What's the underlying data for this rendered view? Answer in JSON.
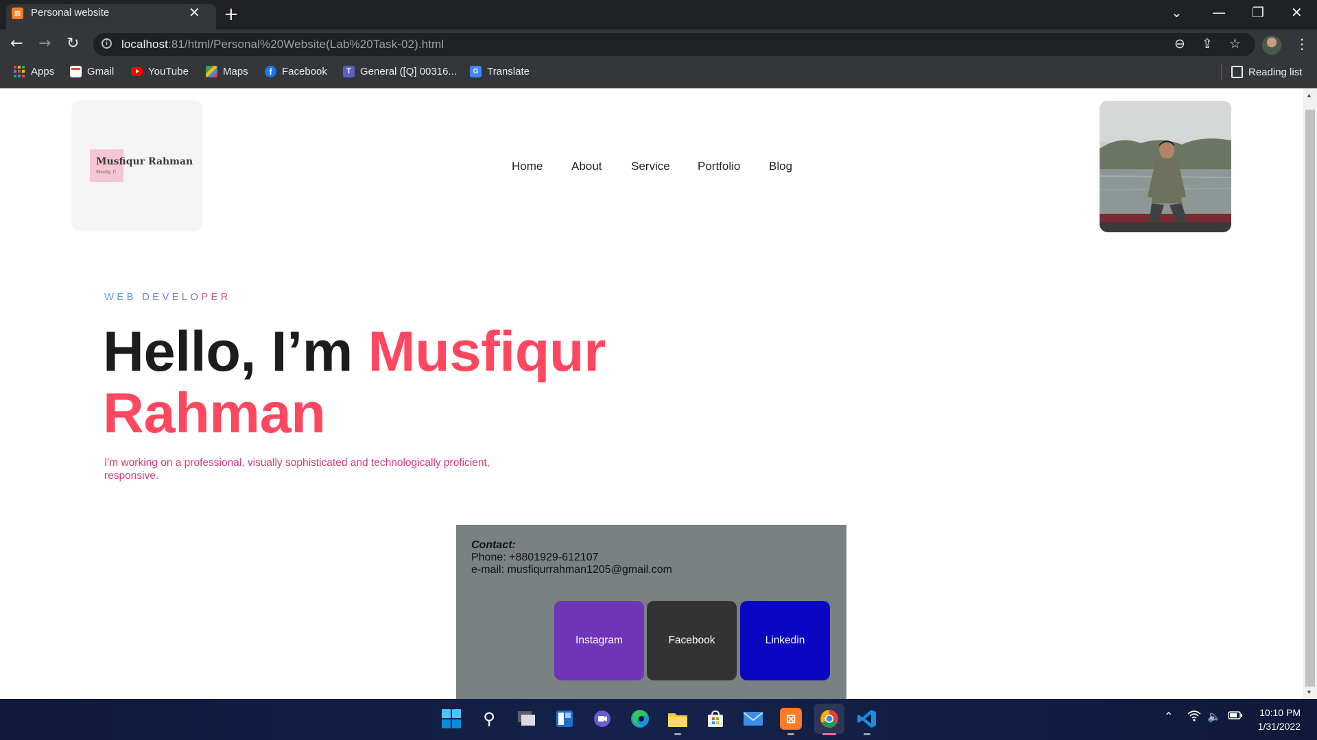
{
  "browser": {
    "tab_title": "Personal website",
    "new_tab": "+",
    "url_host": "localhost",
    "url_path": ":81/html/Personal%20Website(Lab%20Task-02).html",
    "bookmarks": [
      {
        "label": "Apps",
        "icon": "apps-grid-icon"
      },
      {
        "label": "Gmail",
        "icon": "gmail-icon"
      },
      {
        "label": "YouTube",
        "icon": "youtube-icon"
      },
      {
        "label": "Maps",
        "icon": "maps-icon"
      },
      {
        "label": "Facebook",
        "icon": "facebook-icon"
      },
      {
        "label": "General ([Q] 00316...",
        "icon": "teams-icon"
      },
      {
        "label": "Translate",
        "icon": "translate-icon"
      }
    ],
    "reading_list": "Reading list"
  },
  "site": {
    "logo_name": "Musfiqur Rahman",
    "logo_sub": "Musfiq .C",
    "nav": [
      "Home",
      "About",
      "Service",
      "Portfolio",
      "Blog"
    ],
    "subtitle": "WEB DEVELOPER",
    "hero_prefix": "Hello, I’m ",
    "hero_name_first": "Musfiqur",
    "hero_name_last": "Rahman",
    "tagline": "I'm working on a professional, visually sophisticated and technologically proficient, responsive.",
    "contact": {
      "heading": "Contact:",
      "phone": "Phone: +8801929-612107",
      "email": "e-mail: musfiqurrahman1205@gmail.com"
    },
    "social": [
      {
        "label": "Instagram",
        "color": "#6e35b8"
      },
      {
        "label": "Facebook",
        "color": "#333333"
      },
      {
        "label": "Linkedin",
        "color": "#0b06c2"
      }
    ]
  },
  "taskbar": {
    "time": "10:10 PM",
    "date": "1/31/2022"
  }
}
